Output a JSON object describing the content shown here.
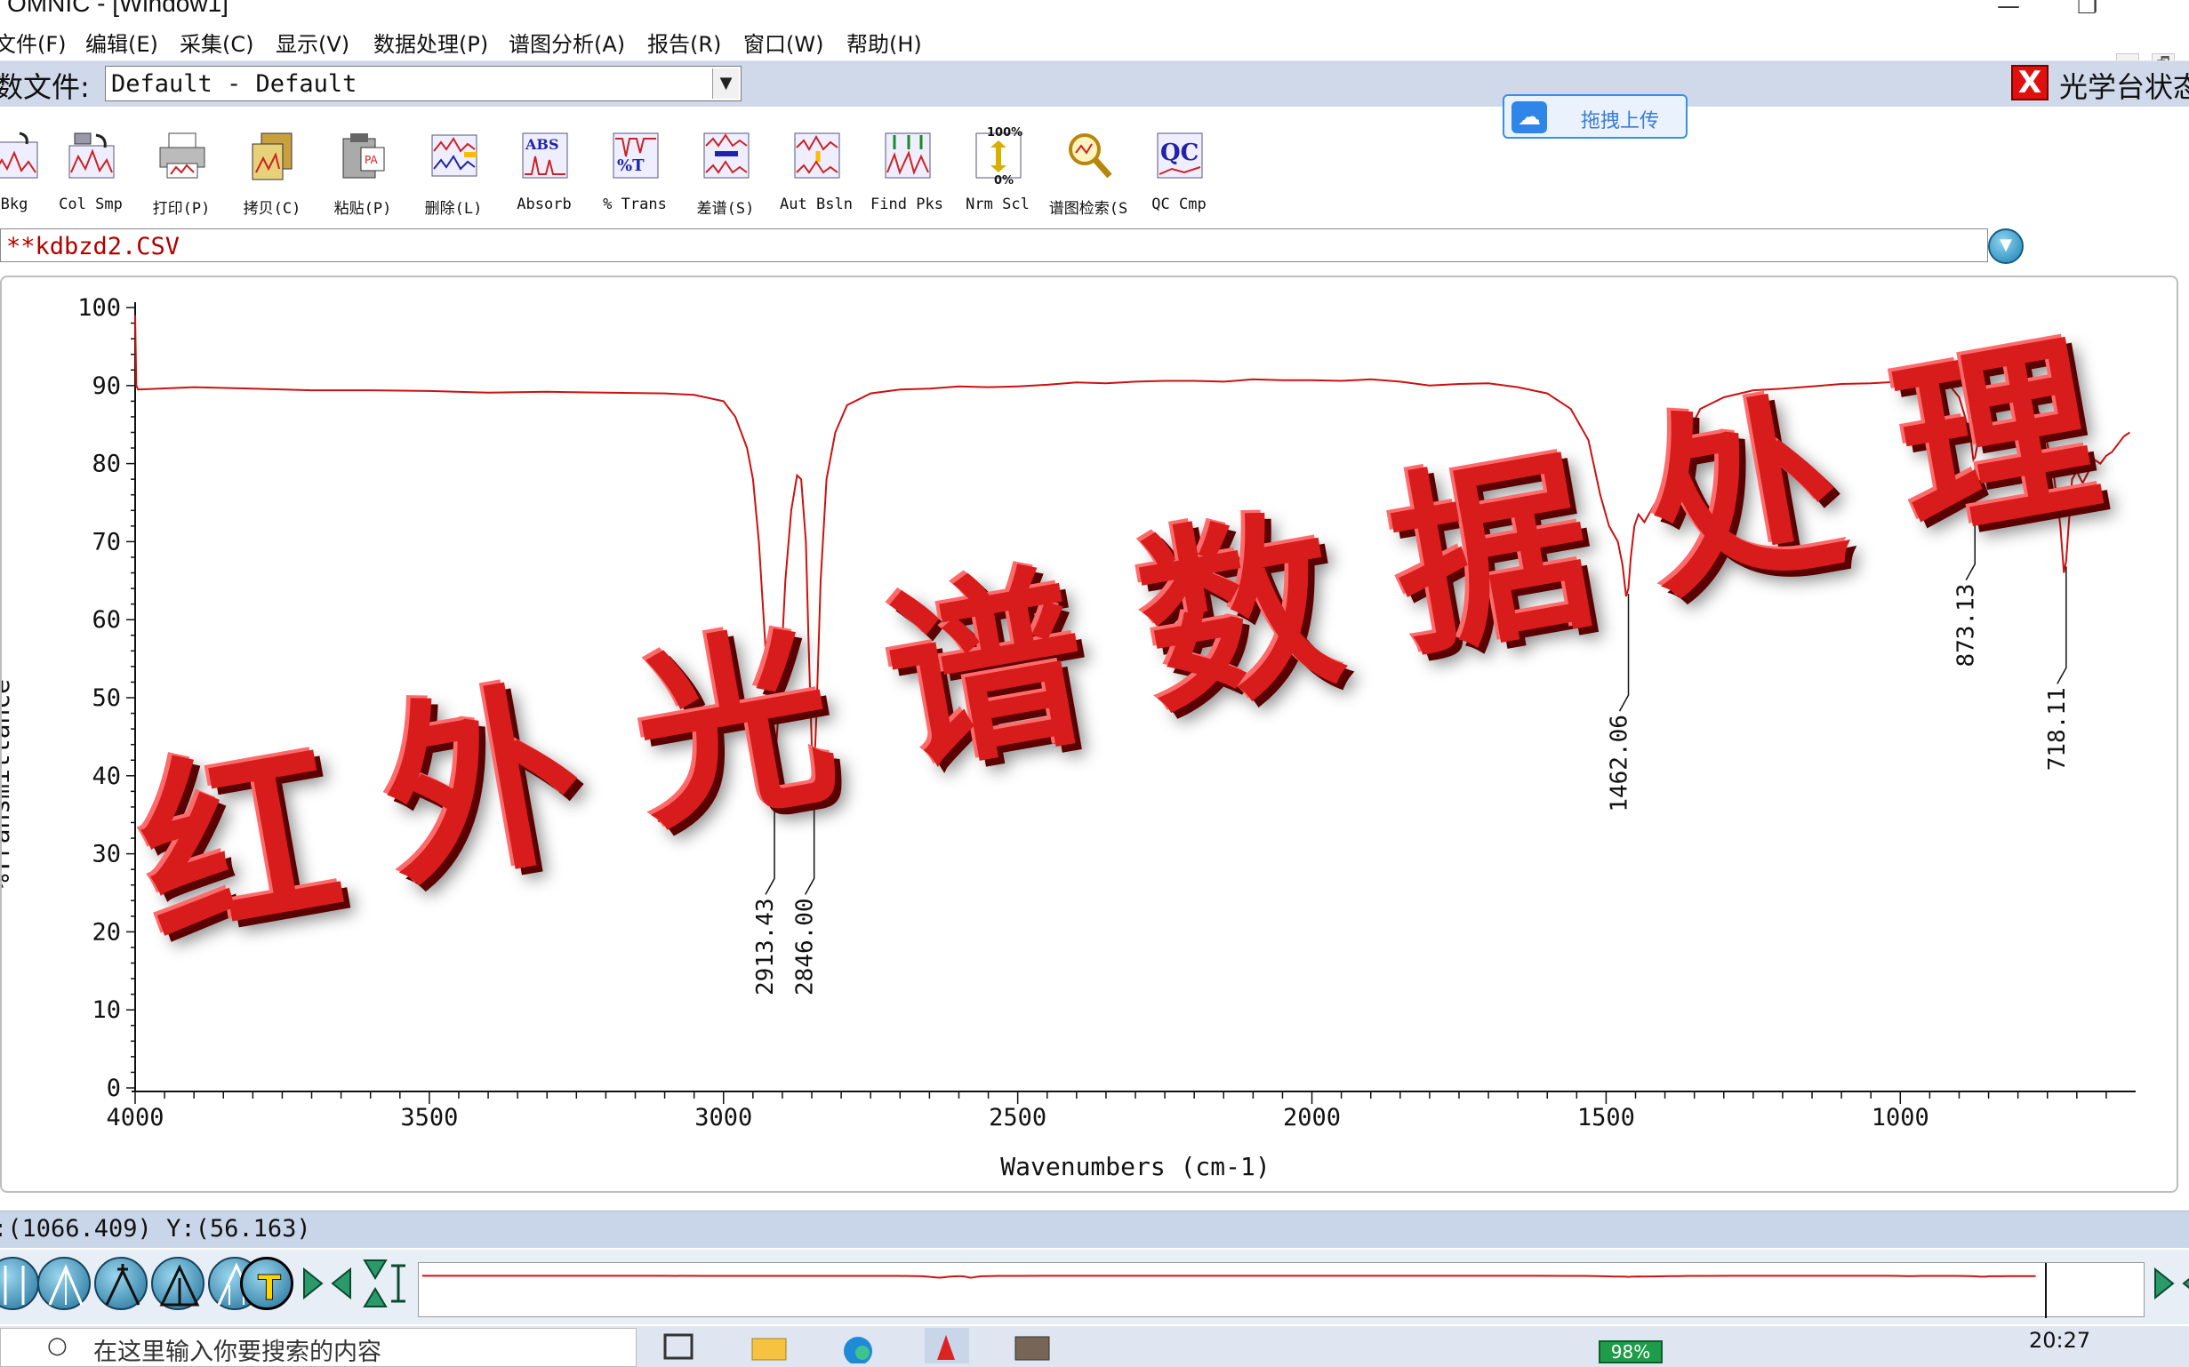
{
  "window": {
    "title": "OMNIC - [Window1]",
    "minimize": "—",
    "restore": "❐",
    "mdi_min": "_",
    "mdi_restore": "🗗"
  },
  "menu": {
    "items": [
      "文件(F)",
      "编辑(E)",
      "采集(C)",
      "显示(V)",
      "数据处理(P)",
      "谱图分析(A)",
      "报告(R)",
      "窗口(W)",
      "帮助(H)"
    ]
  },
  "experiment": {
    "label": "数文件:",
    "value": "Default - Default",
    "bench_icon": "X",
    "bench_status": "光学台状态"
  },
  "toolbar": {
    "tools": [
      {
        "label": "Bkg",
        "icon": "collect-background-icon"
      },
      {
        "label": "Col Smp",
        "icon": "collect-sample-icon"
      },
      {
        "label": "打印(P)",
        "icon": "printer-icon"
      },
      {
        "label": "拷贝(C)",
        "icon": "copy-icon"
      },
      {
        "label": "粘贴(P)",
        "icon": "paste-icon"
      },
      {
        "label": "删除(L)",
        "icon": "delete-spectrum-icon"
      },
      {
        "label": "Absorb",
        "icon": "absorbance-icon"
      },
      {
        "label": "% Trans",
        "icon": "transmittance-icon"
      },
      {
        "label": "差谱(S)",
        "icon": "subtract-icon"
      },
      {
        "label": "Aut Bsln",
        "icon": "auto-baseline-icon"
      },
      {
        "label": "Find Pks",
        "icon": "find-peaks-icon"
      },
      {
        "label": "Nrm Scl",
        "icon": "normalize-scale-icon"
      },
      {
        "label": "谱图检索(S",
        "icon": "search-library-icon"
      },
      {
        "label": "QC Cmp",
        "icon": "qc-compare-icon"
      }
    ],
    "upload_label": "拖拽上传",
    "nrm_scl_top": "100%",
    "nrm_scl_bottom": "0%"
  },
  "file": {
    "name": "**kdbzd2.CSV"
  },
  "watermark": {
    "chars": [
      "红",
      "外",
      "光",
      "谱",
      "数",
      "据",
      "处",
      "理"
    ]
  },
  "chart_data": {
    "type": "line",
    "title": "",
    "xlabel": "Wavenumbers (cm-1)",
    "ylabel": "%Transmittance",
    "xlim": [
      4000,
      600
    ],
    "ylim": [
      0,
      100
    ],
    "x_ticks": [
      4000,
      3500,
      3000,
      2500,
      2000,
      1500,
      1000
    ],
    "y_ticks": [
      0,
      10,
      20,
      30,
      40,
      50,
      60,
      70,
      80,
      90,
      100
    ],
    "grid": false,
    "series": [
      {
        "color": "#cc1111",
        "x": [
          4000,
          3998,
          3995,
          3900,
          3800,
          3700,
          3600,
          3500,
          3400,
          3300,
          3200,
          3100,
          3050,
          3000,
          2980,
          2960,
          2950,
          2940,
          2930,
          2920,
          2913.43,
          2905,
          2895,
          2885,
          2875,
          2868,
          2860,
          2855,
          2850,
          2846,
          2842,
          2835,
          2825,
          2810,
          2790,
          2750,
          2700,
          2650,
          2600,
          2550,
          2500,
          2450,
          2400,
          2350,
          2300,
          2250,
          2200,
          2150,
          2100,
          2050,
          2000,
          1950,
          1900,
          1850,
          1800,
          1750,
          1700,
          1650,
          1600,
          1560,
          1530,
          1510,
          1495,
          1480,
          1472,
          1466,
          1462.06,
          1458,
          1452,
          1445,
          1435,
          1420,
          1400,
          1380,
          1360,
          1340,
          1300,
          1250,
          1200,
          1150,
          1100,
          1050,
          1000,
          960,
          920,
          900,
          890,
          880,
          876,
          873.13,
          870,
          866,
          860,
          850,
          830,
          800,
          780,
          760,
          740,
          728,
          722,
          718.11,
          714,
          708,
          700,
          690,
          680,
          670,
          660,
          650,
          640,
          630,
          620,
          610
        ],
        "y": [
          99,
          90,
          89.5,
          89.8,
          89.6,
          89.4,
          89.4,
          89.3,
          89.1,
          89.2,
          89.1,
          89.0,
          88.8,
          88.0,
          86.0,
          82.0,
          78.0,
          70.0,
          58.0,
          46.0,
          40.5,
          50.0,
          65.0,
          74.0,
          78.5,
          78.0,
          70.0,
          56.0,
          44.0,
          40.5,
          48.0,
          65.0,
          78.0,
          84.0,
          87.5,
          89.0,
          89.5,
          89.6,
          89.9,
          89.8,
          89.9,
          90.1,
          90.4,
          90.3,
          90.5,
          90.6,
          90.6,
          90.5,
          90.8,
          90.7,
          90.7,
          90.6,
          90.8,
          90.5,
          90.0,
          90.2,
          90.3,
          89.8,
          89.0,
          87.0,
          83.0,
          76.0,
          72.0,
          70.0,
          67.0,
          63.0,
          64.0,
          68.0,
          72.0,
          73.5,
          72.5,
          74.5,
          77.0,
          81.0,
          84.0,
          87.0,
          88.5,
          89.4,
          89.6,
          89.9,
          90.2,
          90.3,
          90.5,
          90.8,
          90.4,
          88.5,
          86.0,
          83.0,
          80.5,
          80.8,
          82.0,
          84.0,
          86.5,
          87.5,
          88.3,
          88.7,
          88.3,
          86.0,
          79.0,
          72.0,
          66.0,
          67.5,
          72.0,
          78.0,
          79.0,
          77.5,
          79.0,
          80.5,
          80.0,
          81.0,
          81.5,
          82.5,
          83.5,
          84.0
        ]
      }
    ],
    "peak_labels": [
      {
        "x": 2913.43,
        "text": "2913.43"
      },
      {
        "x": 2846.0,
        "text": "2846.00"
      },
      {
        "x": 1462.06,
        "text": "1462.06"
      },
      {
        "x": 873.13,
        "text": "873.13"
      },
      {
        "x": 718.11,
        "text": "718.11"
      }
    ]
  },
  "status": {
    "text": ":(1066.409) Y:(56.163)"
  },
  "bottom_tools": [
    "region-tool-icon",
    "peak-height-tool-icon",
    "peak-label-tool-icon",
    "peak-area-tool-icon",
    "peak-area-corrected-icon",
    "text-annotation-icon",
    "expand-horizontal-icon",
    "expand-vertical-icon"
  ],
  "taskbar": {
    "search_placeholder": "在这里输入你要搜索的内容",
    "battery": "98%",
    "time": "20:27"
  }
}
